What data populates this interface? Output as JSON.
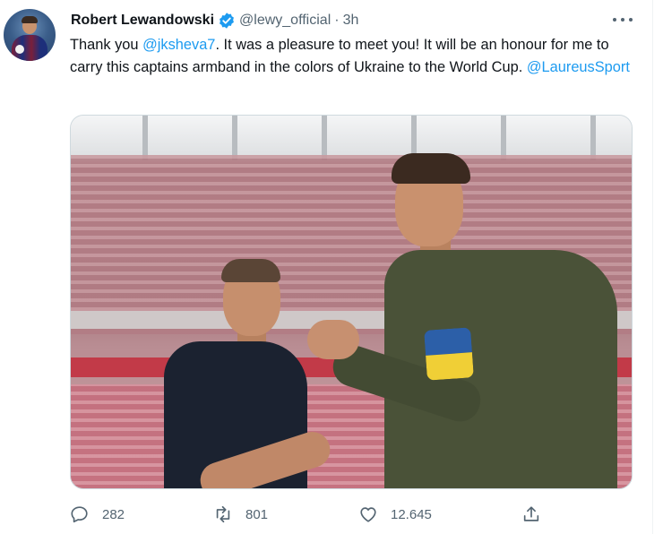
{
  "tweet": {
    "author_name": "Robert Lewandowski",
    "handle": "@lewy_official",
    "separator": "·",
    "time": "3h",
    "text_parts": [
      "Thank you ",
      "@jksheva7",
      ". It was a pleasure to meet you! It will be an honour for me to carry this captains armband in the colors of Ukraine to the World Cup.  ",
      "@LaureusSport"
    ],
    "icons": {
      "verified": "verified-badge-icon",
      "more": "more-icon",
      "reply": "reply-icon",
      "retweet": "retweet-icon",
      "like": "like-icon",
      "share": "share-icon"
    }
  },
  "actions": {
    "reply_count": "282",
    "retweet_count": "801",
    "like_count": "12.645"
  },
  "colors": {
    "accent": "#1d9bf0",
    "text": "#0f1419",
    "secondary_text": "#536471"
  }
}
